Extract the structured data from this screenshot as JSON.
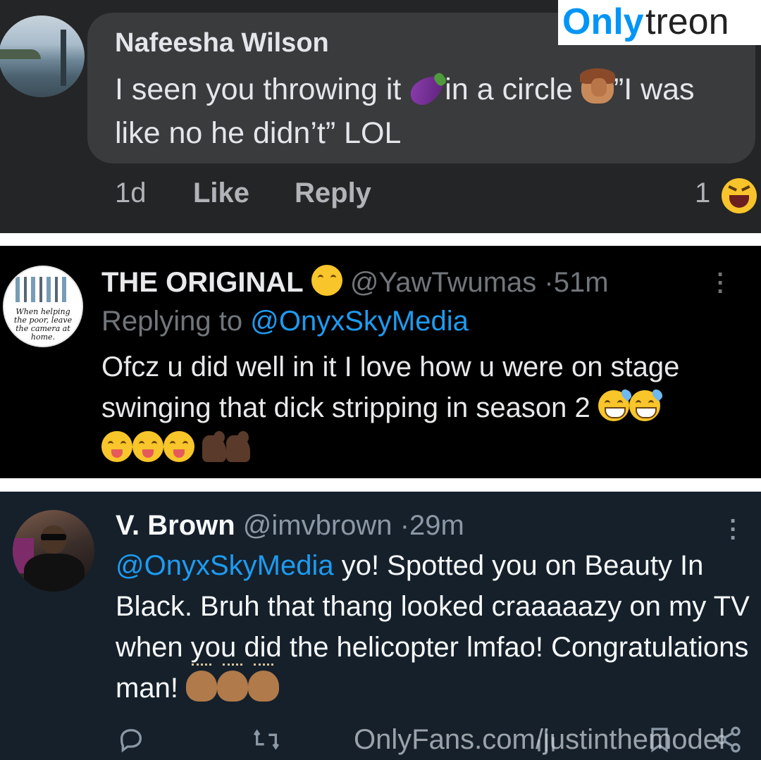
{
  "watermark_top": {
    "part1": "Only",
    "part2": "treon"
  },
  "facebook_comment": {
    "author": "Nafeesha Wilson",
    "text_part1": "I seen you throwing it ",
    "text_part2": "in a circle ",
    "text_part3": "”I was like no he didn’t” LOL",
    "time": "1d",
    "like_label": "Like",
    "reply_label": "Reply",
    "reaction_count": "1",
    "reaction_icon": "haha-emoji-icon"
  },
  "tweet1": {
    "name": "THE ORIGINAL",
    "handle": "@YawTwumas",
    "sep": "·",
    "time": "51m",
    "replying_to_label": "Replying to ",
    "replying_to_handle": "@OnyxSkyMedia",
    "text": "Ofcz u did well in it I love how u were on stage swinging that dick stripping in season 2",
    "avatar_caption": "When helping the poor, leave the camera at home."
  },
  "tweet2": {
    "name": "V. Brown",
    "handle": "@imvbrown",
    "sep": "·",
    "time": "29m",
    "mention": "@OnyxSkyMedia",
    "text": " yo! Spotted you on Beauty In Black. Bruh that thang looked craaaaazy on my TV when you did the helicopter lmfao! Congratulations man!"
  },
  "watermark_bottom": "OnlyFans.com/justinthemodel",
  "colors": {
    "fb_bg": "#242526",
    "fb_bubble": "#3a3b3c",
    "twitter_link": "#1d9bf0",
    "tweet2_bg": "#15202b",
    "watermark_blue": "#0095f6"
  }
}
